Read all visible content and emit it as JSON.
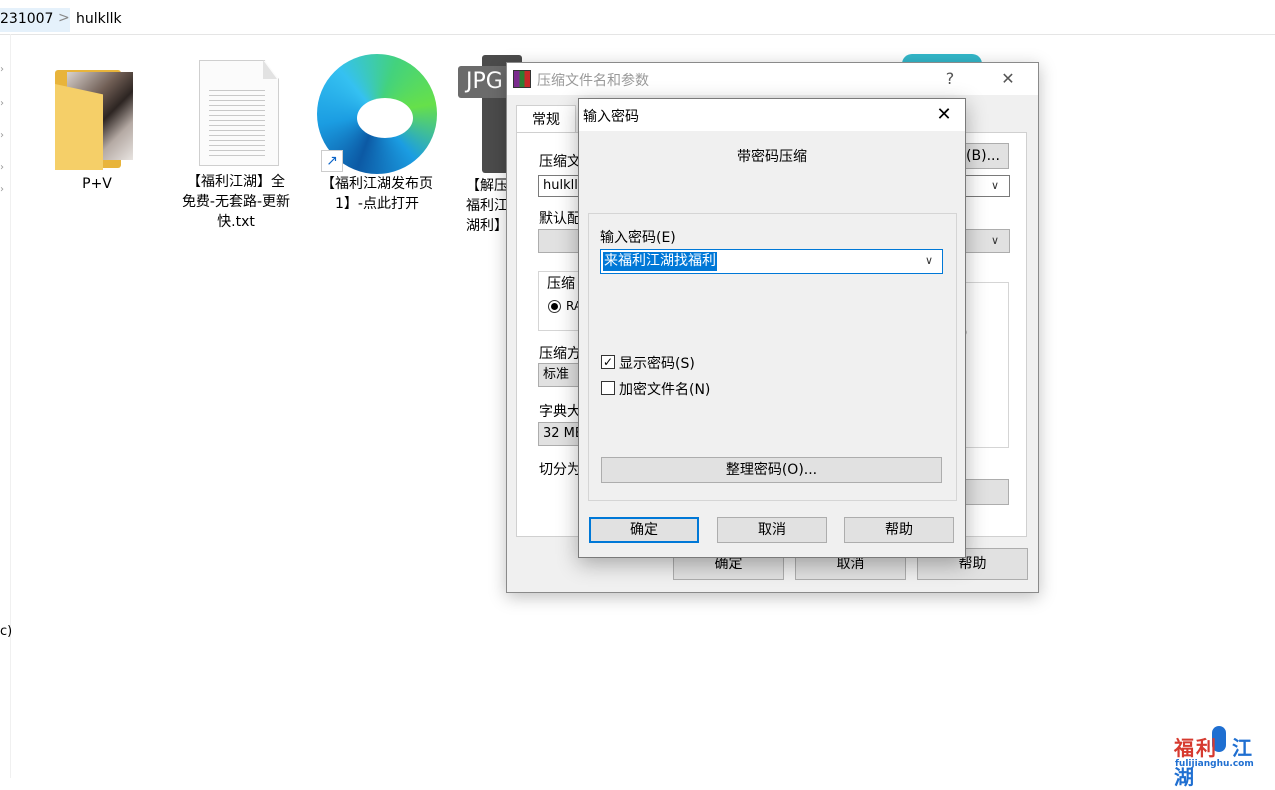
{
  "explorer": {
    "breadcrumb": [
      "231007",
      "hulkllk"
    ],
    "breadcrumb_separator": ">",
    "nav_fragment": "c)"
  },
  "files": [
    {
      "label": "P+V",
      "icon": "folder-icon"
    },
    {
      "label": "【福利江湖】全免费-无套路-更新快.txt",
      "icon": "text-file-icon"
    },
    {
      "label": "【福利江湖发布页1】-点此打开",
      "icon": "edge-browser-icon"
    },
    {
      "label": "【解压福利江湖利】",
      "icon": "jpg-file-icon",
      "jpg_tag": "JPG"
    }
  ],
  "archive_dialog": {
    "title": "压缩文件名和参数",
    "help_glyph": "?",
    "close_glyph": "✕",
    "tab_general": "常规",
    "archive_name_label": "压缩文",
    "browse_button": "(B)...",
    "archive_name_value": "hulkllk.",
    "default_profile_label": "默认配",
    "format_group_label": "压缩",
    "format_option_rar": "RA",
    "method_label": "压缩方",
    "method_value": "标准",
    "dictionary_label": "字典大",
    "dictionary_value": "32 MB",
    "split_label": "切分为",
    "paren_fragment": ")",
    "ok_button": "确定",
    "cancel_button": "取消",
    "help_button": "帮助"
  },
  "password_dialog": {
    "title": "输入密码",
    "close_glyph": "✕",
    "heading": "带密码压缩",
    "password_label": "输入密码(E)",
    "password_value": "来福利江湖找福利",
    "show_password_label": "显示密码(S)",
    "show_password_checked": true,
    "encrypt_filenames_label": "加密文件名(N)",
    "encrypt_filenames_checked": false,
    "organize_button": "整理密码(O)...",
    "ok_button": "确定",
    "cancel_button": "取消",
    "help_button": "帮助"
  },
  "watermark": {
    "text_red": "福利",
    "text_blue": "江湖",
    "domain": "fulijianghu.com"
  },
  "colors": {
    "accent": "#0078d7",
    "dialog_bg": "#f0f0f0",
    "folder": "#f5cf68"
  }
}
